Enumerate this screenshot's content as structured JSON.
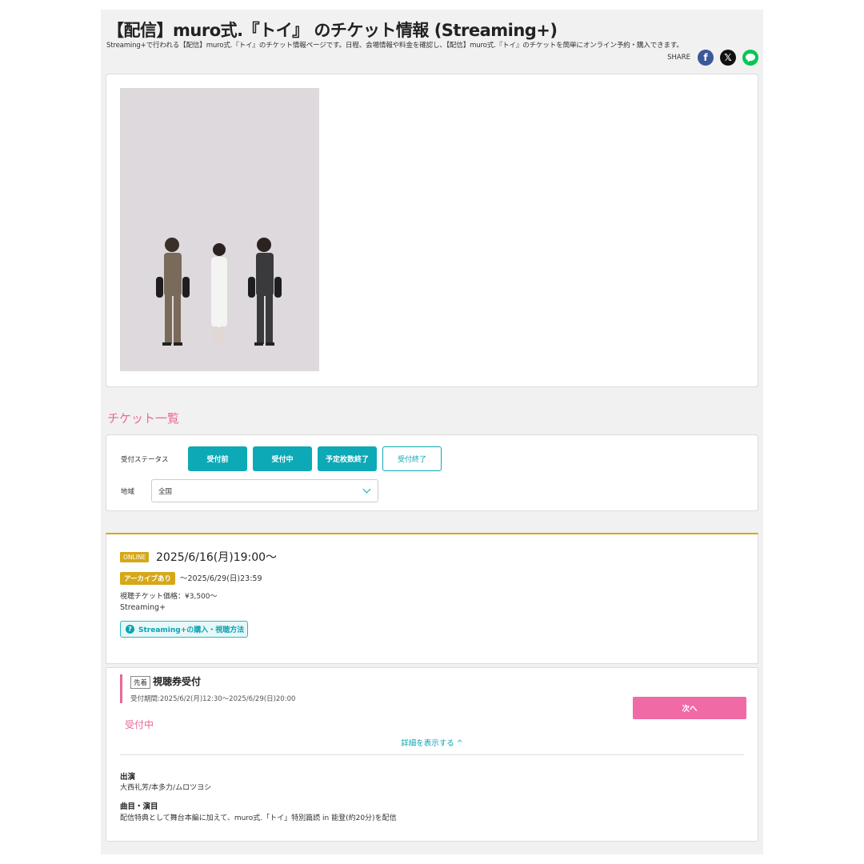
{
  "header": {
    "title": "【配信】muro式.『トイ』 のチケット情報 (Streaming+)",
    "description": "Streaming+で行われる【配信】muro式.『トイ』のチケット情報ページです。日程、会場情報や料金を確認し、【配信】muro式.『トイ』のチケットを簡単にオンライン予約・購入できます。",
    "share_label": "SHARE"
  },
  "section_title": "チケット一覧",
  "filter": {
    "status_label": "受付ステータス",
    "buttons": [
      "受付前",
      "受付中",
      "予定枚数終了",
      "受付終了"
    ],
    "region_label": "地域",
    "region_value": "全国"
  },
  "event": {
    "online_badge": "ONLINE",
    "datetime": "2025/6/16(月)19:00〜",
    "archive_badge": "アーカイブあり",
    "archive_until": "〜2025/6/29(日)23:59",
    "price": "視聴チケット価格：¥3,500〜",
    "platform": "Streaming+",
    "howto_label": "Streaming+の購入・視聴方法"
  },
  "sale": {
    "type_badge": "先着",
    "name": "視聴券受付",
    "period": "受付期間:2025/6/2(月)12:30〜2025/6/29(日)20:00",
    "next_label": "次へ",
    "status": "受付中",
    "details_toggle": "詳細を表示する ^",
    "cast_heading": "出演",
    "cast": "大西礼芳/本多力/ムロツヨシ",
    "program_heading": "曲目・演目",
    "program": "配信特典として舞台本編に加えて、muro式.「トイ」特別篇読 in 能登(約20分)を配信"
  },
  "colors": {
    "accent_teal": "#0da9b6",
    "accent_pink": "#e8679a",
    "gold": "#d6a818"
  }
}
